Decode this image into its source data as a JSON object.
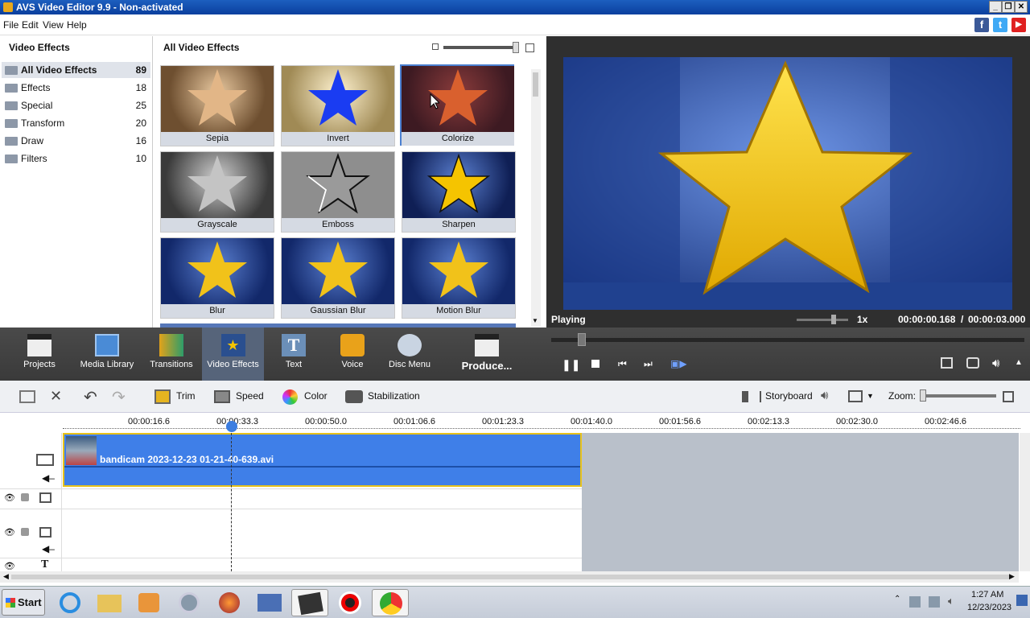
{
  "window": {
    "title": "AVS Video Editor 9.9 - Non-activated"
  },
  "menu": {
    "items": [
      "File",
      "Edit",
      "View",
      "Help"
    ]
  },
  "social": {
    "facebook": "f",
    "twitter": "t",
    "youtube": "▶"
  },
  "left_panel": {
    "title": "Video Effects",
    "categories": [
      {
        "label": "All Video Effects",
        "count": "89"
      },
      {
        "label": "Effects",
        "count": "18"
      },
      {
        "label": "Special",
        "count": "25"
      },
      {
        "label": "Transform",
        "count": "20"
      },
      {
        "label": "Draw",
        "count": "16"
      },
      {
        "label": "Filters",
        "count": "10"
      }
    ]
  },
  "effects_panel": {
    "title": "All Video Effects",
    "items": [
      "Sepia",
      "Invert",
      "Colorize",
      "Grayscale",
      "Emboss",
      "Sharpen",
      "Blur",
      "Gaussian Blur",
      "Motion Blur"
    ]
  },
  "preview": {
    "status": "Playing",
    "speed": "1x",
    "current_time": "00:00:00.168",
    "separator": "/",
    "total_time": "00:00:03.000",
    "progress": 0.056
  },
  "toolbar": {
    "items": [
      "Projects",
      "Media Library",
      "Transitions",
      "Video Effects",
      "Text",
      "Voice",
      "Disc Menu",
      "Produce..."
    ]
  },
  "timeline_tools": {
    "trim": "Trim",
    "speed": "Speed",
    "color": "Color",
    "stabilization": "Stabilization",
    "storyboard": "Storyboard",
    "zoom": "Zoom:"
  },
  "ruler": {
    "ticks": [
      "00:00:16.6",
      "00:00:33.3",
      "00:00:50.0",
      "00:01:06.6",
      "00:01:23.3",
      "00:01:40.0",
      "00:01:56.6",
      "00:02:13.3",
      "00:02:30.0",
      "00:02:46.6"
    ]
  },
  "clip": {
    "name": "bandicam 2023-12-23 01-21-40-639.avi"
  },
  "taskbar": {
    "start": "Start",
    "time": "1:27 AM",
    "date": "12/23/2023"
  },
  "colors": {
    "accent": "#3f7ee0",
    "clip": "#3f7fe8",
    "toolbar": "#3d3d3d"
  }
}
